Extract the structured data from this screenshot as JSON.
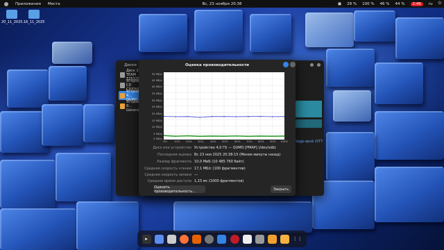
{
  "topbar": {
    "apps_label": "Приложения",
    "places_label": "Места",
    "clock": "Вс, 23 ноября 20:38",
    "battery": "28 %",
    "volume": "100 %",
    "wifi": "46 %",
    "net": "44 %",
    "time_badge": "2:46",
    "lang": "ru"
  },
  "desktop": {
    "icons": [
      {
        "label": "20_11_2025..."
      },
      {
        "label": "16_11_2025"
      }
    ]
  },
  "disks_window": {
    "title": "Диски",
    "items": [
      {
        "name": "Диск 256 ГБ",
        "sub": "TEAM T253256GB"
      },
      {
        "name": "Устройство CD",
        "sub": "CD/DVD"
      },
      {
        "name": "Устройство 4...",
        "sub": "QUMO"
      },
      {
        "name": "Устройство 8...",
        "sub": "General USB"
      }
    ],
    "side_text": "Nagp-apuk (ST7"
  },
  "benchmark": {
    "title": "Оценка производительности",
    "y_ticks": [
      "50 MБ/с",
      "45 MБ/с",
      "40 MБ/с",
      "35 MБ/с",
      "30 MБ/с",
      "25 MБ/с",
      "20 MБ/с",
      "15 MБ/с",
      "10 MБ/с",
      "5 MБ/с",
      "0 MБ/с"
    ],
    "x_ticks": [
      "0%",
      "10%",
      "20%",
      "30%",
      "40%",
      "50%",
      "60%",
      "70%",
      "80%",
      "90%",
      "100%"
    ],
    "rows": [
      {
        "k": "Диск или устройство",
        "v": "Устройство 4,0 ГБ — QUMO [PMAP] (/dev/sdb)"
      },
      {
        "k": "Последняя оценка",
        "v": "Вс 23 ноя 2025 20:38:15 (Менее минуты назад)"
      },
      {
        "k": "Размер фрагмента",
        "v": "10,0 MиБ (10 485 760 байт)"
      },
      {
        "k": "Средняя скорость чтения",
        "v": "17,1 MБ/с (100 фрагментов)"
      },
      {
        "k": "Средняя скорость записи",
        "v": "—"
      },
      {
        "k": "Среднее время доступа",
        "v": "1,15 мс (1000 фрагментов)"
      }
    ],
    "start_button": "Оценить производительность...",
    "close_button": "Закрыть"
  },
  "chart_data": {
    "type": "line",
    "x": [
      0,
      10,
      20,
      30,
      40,
      50,
      60,
      70,
      80,
      90,
      100
    ],
    "xlabel": "",
    "ylabel": "",
    "xlim": [
      0,
      100
    ],
    "ylim": [
      0,
      50
    ],
    "series": [
      {
        "values": [
          17.2,
          17.0,
          17.1,
          16.5,
          17.1,
          17.1,
          17.0,
          17.1,
          17.2,
          17.0,
          17.1
        ],
        "color": "#3d3dcc"
      },
      {
        "values": [
          3,
          2.5,
          2.8,
          2.4,
          2.6,
          2.5,
          2.7,
          2.4,
          2.6,
          2.5,
          2.6
        ],
        "color": "#2e9e2e"
      }
    ]
  },
  "dock": {
    "items": [
      "terminal-icon",
      "files-icon",
      "text-editor-icon",
      "firefox-icon",
      "software-icon",
      "settings-icon",
      "extensions-icon",
      "cherry-icon",
      "document-viewer-icon",
      "printer-icon",
      "disks-icon",
      "folder-icon",
      "app-grid-icon"
    ]
  }
}
